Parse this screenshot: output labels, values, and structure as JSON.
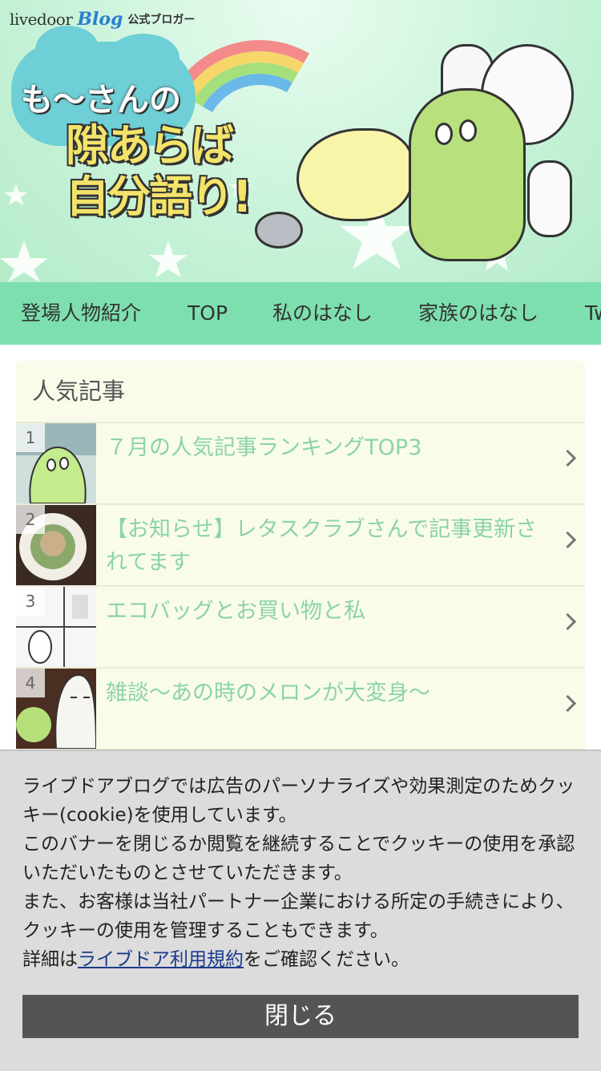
{
  "header": {
    "brand_livedoor": "livedoor",
    "brand_blog": "Blog",
    "brand_official": "公式ブロガー",
    "title_sub": "も〜さんの",
    "title_main": "隙あらば自分語り!",
    "colors": {
      "background": "#c9f3da",
      "cloud": "#6ecfd6",
      "title_yellow": "#f3e36a"
    }
  },
  "nav": {
    "items": [
      {
        "label": "登場人物紹介"
      },
      {
        "label": "TOP"
      },
      {
        "label": "私のはなし"
      },
      {
        "label": "家族のはなし"
      },
      {
        "label": "Tw"
      }
    ],
    "color": "#7ddfae"
  },
  "popular": {
    "title": "人気記事",
    "items": [
      {
        "rank": "1",
        "title": "７月の人気記事ランキングTOP3",
        "thumb_icon": "green-blob-character-thumbnail"
      },
      {
        "rank": "2",
        "title": "【お知らせ】レタスクラブさんで記事更新されてます",
        "thumb_icon": "food-plate-thumbnail"
      },
      {
        "rank": "3",
        "title": "エコバッグとお買い物と私",
        "thumb_icon": "manga-panel-thumbnail"
      },
      {
        "rank": "4",
        "title": "雑談～あの時のメロンが大変身～",
        "thumb_icon": "melon-character-thumbnail"
      }
    ],
    "title_color": "#8bd3a8"
  },
  "cookie": {
    "line1": "ライブドアブログでは広告のパーソナライズや効果測定のためクッキー(cookie)を使用しています。",
    "line2": "このバナーを閉じるか閲覧を継続することでクッキーの使用を承認いただいたものとさせていただきます。",
    "line3": "また、お客様は当社パートナー企業における所定の手続きにより、クッキーの使用を管理することもできます。",
    "detail_prefix": "詳細は",
    "detail_link": "ライブドア利用規約",
    "detail_suffix": "をご確認ください。",
    "close_label": "閉じる"
  }
}
